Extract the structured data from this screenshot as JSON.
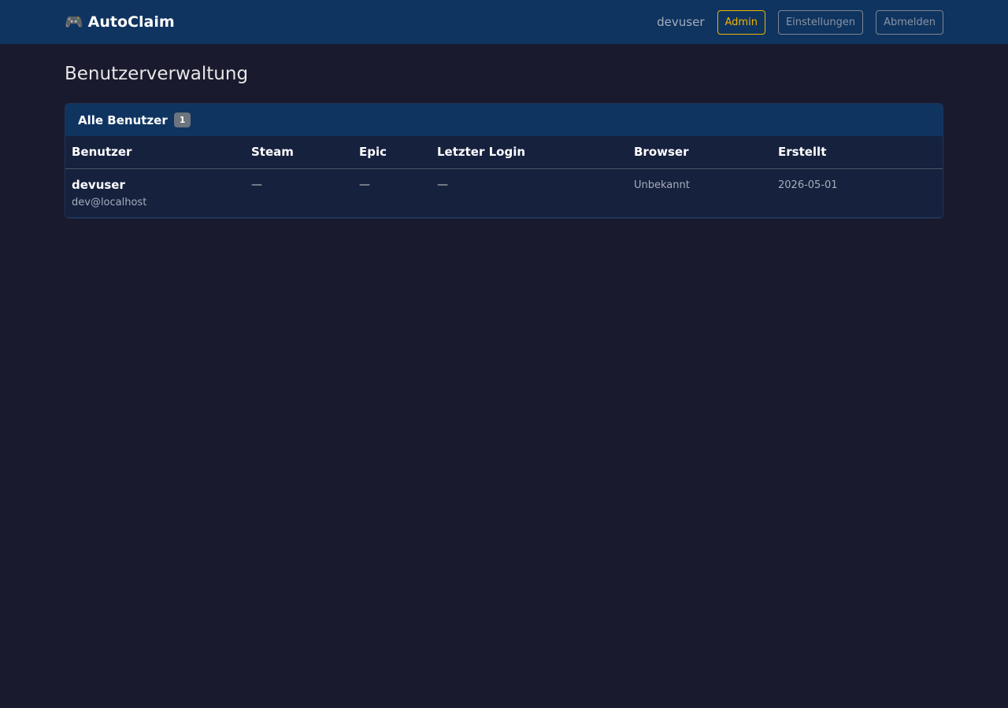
{
  "navbar": {
    "brand_icon": "🎮",
    "brand": "AutoClaim",
    "username": "devuser",
    "admin_label": "Admin",
    "settings_label": "Einstellungen",
    "logout_label": "Abmelden"
  },
  "page": {
    "title": "Benutzerverwaltung"
  },
  "users_card": {
    "title": "Alle Benutzer",
    "count": "1",
    "columns": [
      "Benutzer",
      "Steam",
      "Epic",
      "Letzter Login",
      "Browser",
      "Erstellt"
    ],
    "rows": [
      {
        "name": "devuser",
        "email": "dev@localhost",
        "steam": "—",
        "epic": "—",
        "last_login": "—",
        "browser": "Unbekannt",
        "created": "2026-05-01"
      }
    ]
  },
  "colors": {
    "background": "#1a1a2e",
    "navbar": "#0f3460",
    "admin_accent": "#f0b400"
  }
}
